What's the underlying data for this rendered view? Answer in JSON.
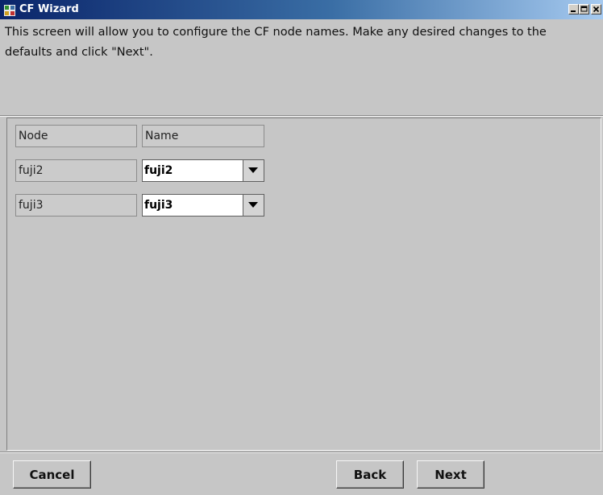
{
  "window": {
    "title": "CF Wizard",
    "titlebar_color": "#0a246a"
  },
  "instructions": "This screen will allow you to configure the CF node names.  Make any desired changes to the defaults and click \"Next\".",
  "table": {
    "headers": {
      "node": "Node",
      "name": "Name"
    },
    "rows": [
      {
        "node": "fuji2",
        "name": "fuji2"
      },
      {
        "node": "fuji3",
        "name": "fuji3"
      }
    ]
  },
  "buttons": {
    "cancel": "Cancel",
    "back": "Back",
    "next": "Next"
  },
  "icons": {
    "app": "cf-wizard-app-icon",
    "minimize": "minimize-icon",
    "maximize": "maximize-icon",
    "close": "close-icon",
    "dropdown": "chevron-down-icon"
  }
}
